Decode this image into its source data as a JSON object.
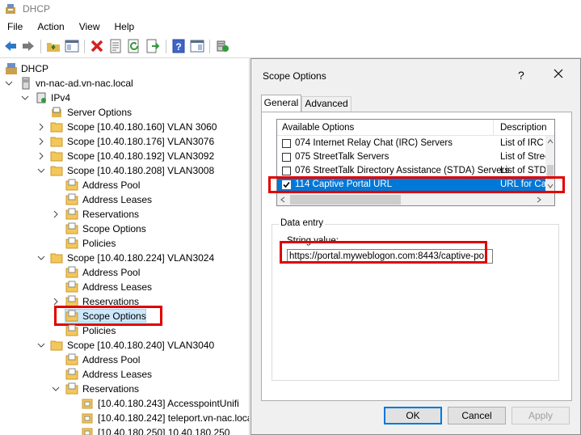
{
  "window": {
    "title": "DHCP"
  },
  "menu": {
    "items": [
      "File",
      "Action",
      "View",
      "Help"
    ]
  },
  "toolbar": {
    "buttons": [
      "back-icon",
      "forward-icon",
      "up-folder-icon",
      "show-pane-icon",
      "delete-icon",
      "properties-icon",
      "refresh-icon",
      "export-icon",
      "help-icon",
      "details-pane-icon",
      "dhcp-server-icon"
    ]
  },
  "tree": {
    "root": "DHCP",
    "server": "vn-nac-ad.vn-nac.local",
    "ipv4": "IPv4",
    "server_options": "Server Options",
    "scope_3060": "Scope [10.40.180.160] VLAN 3060",
    "scope_3076": "Scope [10.40.180.176] VLAN3076",
    "scope_3092": "Scope [10.40.180.192] VLAN3092",
    "scope_3008": "Scope [10.40.180.208] VLAN3008",
    "s3008_address_pool": "Address Pool",
    "s3008_address_leases": "Address Leases",
    "s3008_reservations": "Reservations",
    "s3008_scope_options": "Scope Options",
    "s3008_policies": "Policies",
    "scope_3024": "Scope [10.40.180.224] VLAN3024",
    "s3024_address_pool": "Address Pool",
    "s3024_address_leases": "Address Leases",
    "s3024_reservations": "Reservations",
    "s3024_scope_options": "Scope Options",
    "s3024_policies": "Policies",
    "scope_3040": "Scope [10.40.180.240] VLAN3040",
    "s3040_address_pool": "Address Pool",
    "s3040_address_leases": "Address Leases",
    "s3040_reservations": "Reservations",
    "res_1": "[10.40.180.243] AccesspointUnifi",
    "res_2": "[10.40.180.242] teleport.vn-nac.loca",
    "res_3": "[10.40.180.250] 10.40.180.250"
  },
  "dialog": {
    "title": "Scope Options",
    "help_glyph": "?",
    "tabs": [
      "General",
      "Advanced"
    ],
    "list": {
      "col_options": "Available Options",
      "col_description": "Description",
      "rows": [
        {
          "name": "074 Internet Relay Chat (IRC) Servers",
          "desc": "List of IRC s",
          "checked": false
        },
        {
          "name": "075 StreetTalk Servers",
          "desc": "List of Street",
          "checked": false
        },
        {
          "name": "076 StreetTalk Directory Assistance (STDA) Servers",
          "desc": "List of STDA",
          "checked": false
        },
        {
          "name": "114 Captive Portal URL",
          "desc": "URL for Cap",
          "checked": true
        }
      ]
    },
    "data_entry": {
      "group_label": "Data entry",
      "string_label": "String value:",
      "string_value": "https://portal.myweblogon.com:8443/captive-po"
    },
    "buttons": {
      "ok": "OK",
      "cancel": "Cancel",
      "apply": "Apply"
    }
  },
  "colors": {
    "highlight_red": "#e00000",
    "selection_blue": "#0078d7",
    "folder_yellow": "#f3c75a"
  }
}
